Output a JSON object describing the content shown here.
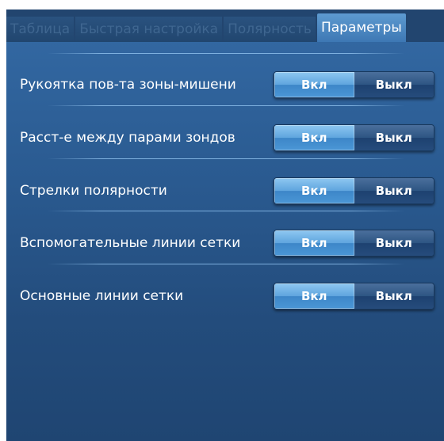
{
  "tabs": [
    {
      "label": "Таблица",
      "active": false
    },
    {
      "label": "Быстрая настройка",
      "active": false
    },
    {
      "label": "Полярность",
      "active": false
    },
    {
      "label": "Параметры",
      "active": true
    }
  ],
  "settings": [
    {
      "label": "Рукоятка пов-та зоны-мишени",
      "on_label": "Вкл",
      "off_label": "Выкл",
      "selected": "on"
    },
    {
      "label": "Расст-е между парами зондов",
      "on_label": "Вкл",
      "off_label": "Выкл",
      "selected": "on"
    },
    {
      "label": "Стрелки полярности",
      "on_label": "Вкл",
      "off_label": "Выкл",
      "selected": "on"
    },
    {
      "label": "Вспомогательные линии сетки",
      "on_label": "Вкл",
      "off_label": "Выкл",
      "selected": "on"
    },
    {
      "label": "Основные линии сетки",
      "on_label": "Вкл",
      "off_label": "Выкл",
      "selected": "on"
    }
  ],
  "colors": {
    "panel_bg": "#22456f",
    "active_tab": "#5d9ad0",
    "toggle_on": "#5fa5de",
    "toggle_off": "#1d4170"
  }
}
